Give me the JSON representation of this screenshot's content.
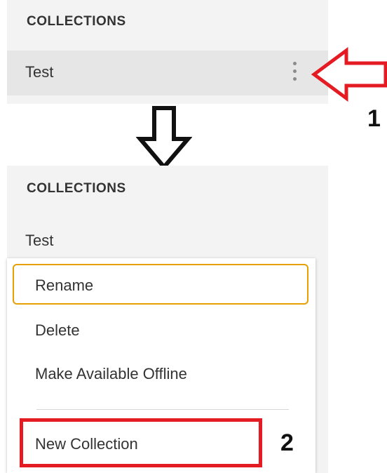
{
  "before": {
    "section_title": "COLLECTIONS",
    "collection_name": "Test",
    "more_options_icon": "vertical-ellipsis-icon"
  },
  "after": {
    "section_title": "COLLECTIONS",
    "collection_name": "Test",
    "context_menu": {
      "items": [
        {
          "label": "Rename",
          "focused": true
        },
        {
          "label": "Delete"
        },
        {
          "label": "Make Available Offline"
        },
        {
          "label": "New Collection"
        }
      ]
    }
  },
  "annotations": {
    "step1": "1",
    "step2": "2",
    "arrow_color": "#e41b23",
    "highlight_color": "#e41b23",
    "focus_color": "#e6a000"
  }
}
